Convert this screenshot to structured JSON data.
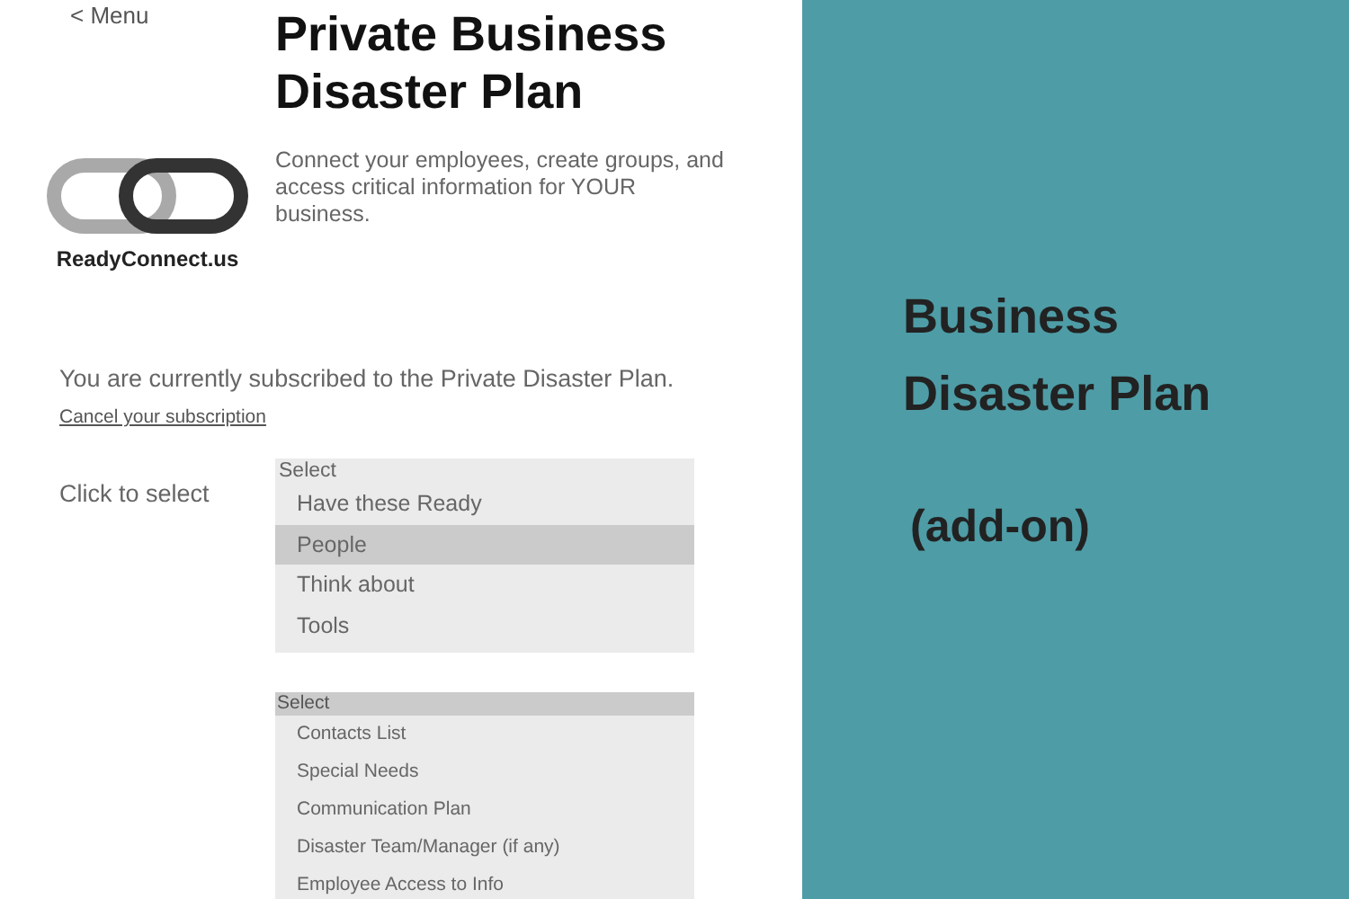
{
  "back_link": "< Menu",
  "title": "Private Business Disaster Plan",
  "logo": {
    "text": "ReadyConnect.us"
  },
  "subtitle": "Connect your employees, create groups, and access critical information for YOUR business.",
  "subscription": {
    "message": "You are currently subscribed to the Private Disaster Plan.",
    "cancel_link": "Cancel your subscription"
  },
  "select_label": "Click to select",
  "lists": [
    {
      "header": {
        "label": "Select",
        "selected": false
      },
      "options": [
        {
          "label": "Have these Ready",
          "selected": false
        },
        {
          "label": "People",
          "selected": true
        },
        {
          "label": "Think about",
          "selected": false
        },
        {
          "label": "Tools",
          "selected": false
        }
      ]
    },
    {
      "header": {
        "label": "Select",
        "selected": true
      },
      "options": [
        {
          "label": "Contacts List",
          "selected": false
        },
        {
          "label": "Special Needs",
          "selected": false
        },
        {
          "label": "Communication Plan",
          "selected": false
        },
        {
          "label": "Disaster Team/Manager (if any)",
          "selected": false
        },
        {
          "label": "Employee Access to Info",
          "selected": false
        }
      ]
    }
  ],
  "side_panel": {
    "heading": "Business Disaster Plan",
    "note": "(add-on)"
  }
}
